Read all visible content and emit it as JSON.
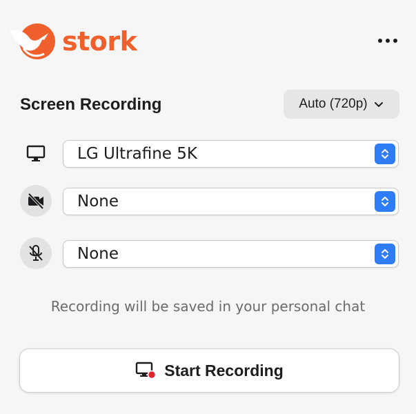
{
  "brand": {
    "name": "stork",
    "color": "#f0602c"
  },
  "header": {
    "more_icon": "more-horizontal-icon"
  },
  "recording": {
    "title": "Screen Recording",
    "quality": "Auto (720p)",
    "display": {
      "value": "LG Ultrafine 5K",
      "icon": "monitor-icon"
    },
    "camera": {
      "value": "None",
      "icon": "camera-off-icon"
    },
    "microphone": {
      "value": "None",
      "icon": "mic-off-icon"
    },
    "info": "Recording will be saved in your personal chat",
    "start_label": "Start Recording"
  },
  "colors": {
    "accent": "#2f7df6",
    "record": "#e0242b"
  }
}
